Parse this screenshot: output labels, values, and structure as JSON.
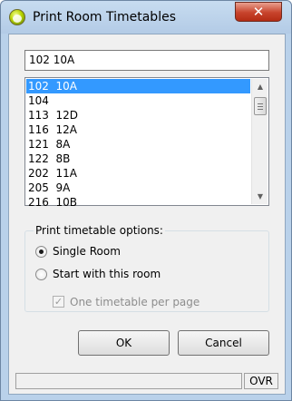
{
  "window": {
    "title": "Print Room Timetables",
    "close_glyph": "✕",
    "icon": "app-ball-icon"
  },
  "room_input": {
    "value": "102  10A"
  },
  "room_list": {
    "selected_index": 0,
    "items": [
      "102  10A",
      "104",
      "113  12D",
      "116  12A",
      "121  8A",
      "122  8B",
      "202  11A",
      "205  9A",
      "216  10B"
    ]
  },
  "scrollbar": {
    "up_glyph": "▲",
    "down_glyph": "▼"
  },
  "options": {
    "legend": "Print timetable options:",
    "single_room_label": "Single Room",
    "single_room_selected": true,
    "start_with_label": "Start with this room",
    "start_with_selected": false,
    "one_per_page_label": "One timetable per page",
    "one_per_page_checked": true,
    "one_per_page_enabled": false,
    "check_glyph": "✓"
  },
  "buttons": {
    "ok_label": "OK",
    "cancel_label": "Cancel"
  },
  "statusbar": {
    "mode": "OVR"
  },
  "colors": {
    "selection": "#3399ff",
    "close_button": "#c7432c"
  }
}
